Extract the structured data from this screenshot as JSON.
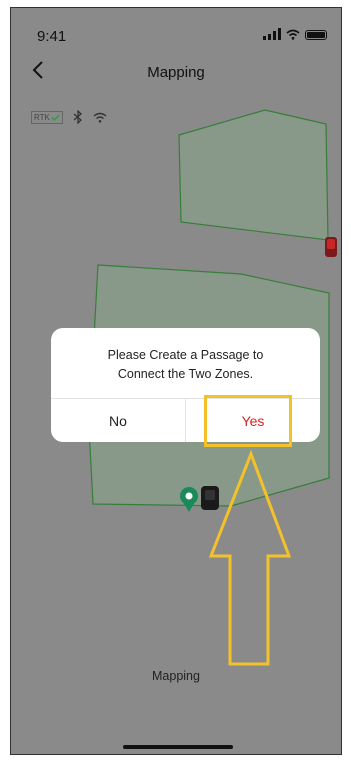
{
  "status_bar": {
    "time": "9:41"
  },
  "nav": {
    "title": "Mapping"
  },
  "indicators": {
    "rtk_label": "RTK"
  },
  "dialog": {
    "line1": "Please Create a Passage to",
    "line2": "Connect the Two Zones.",
    "no_label": "No",
    "yes_label": "Yes"
  },
  "footer": {
    "label": "Mapping"
  },
  "colors": {
    "overlay": "#8a8a8a",
    "zone_border": "#2e7d32",
    "yes_text": "#d81f1f",
    "highlight": "#f3c12a"
  }
}
